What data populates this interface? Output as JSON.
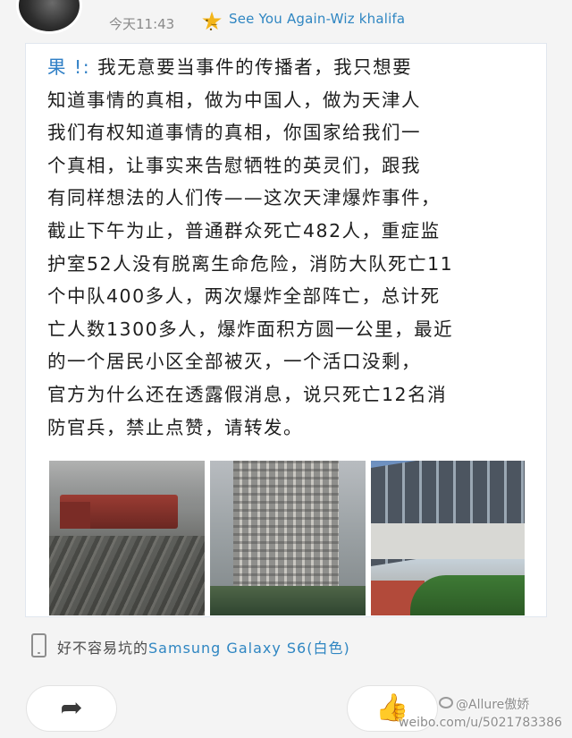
{
  "header": {
    "timestamp": "今天11:43",
    "source_label": "See You Again-Wiz khalifa",
    "badge_icon": "star-emoji-icon",
    "badge_color": "#f3b51a"
  },
  "post": {
    "author_prefix": "果 !:",
    "lines": [
      " 我无意要当事件的传播者，我只想要",
      "知道事情的真相，做为中国人，做为天津人",
      "我们有权知道事情的真相，你国家给我们一",
      "个真相，让事实来告慰牺牲的英灵们，跟我",
      "有同样想法的人们传——这次天津爆炸事件，",
      "截止下午为止，普通群众死亡482人，重症监",
      "护室52人没有脱离生命危险，消防大队死亡11",
      "个中队400多人，两次爆炸全部阵亡，总计死",
      "亡人数1300多人，爆炸面积方圆一公里，最近",
      "的一个居民小区全部被灭，一个活口没剩，",
      "官方为什么还在透露假消息，说只死亡12名消",
      "防官兵，禁止点赞，请转发。"
    ],
    "author_color": "#2f7fc6"
  },
  "device": {
    "prefix": "好不容易坑的",
    "model": "Samsung Galaxy S6(白色)",
    "icon": "phone-icon"
  },
  "actions": {
    "share_icon": "share-arrow-icon",
    "like_icon": "thumbs-up-icon"
  },
  "watermark": {
    "handle": "@Allure傲娇",
    "url": "weibo.com/u/5021783386"
  }
}
